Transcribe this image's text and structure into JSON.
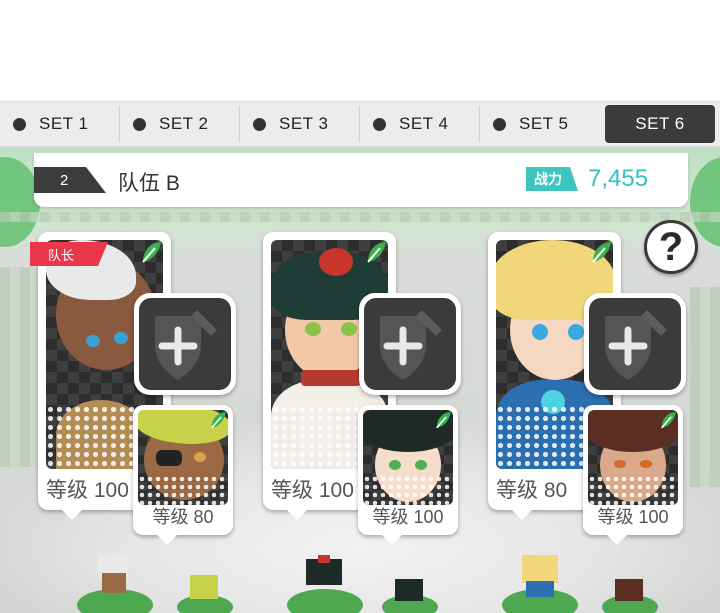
{
  "tabs": [
    {
      "label": "SET 1",
      "active": false
    },
    {
      "label": "SET 2",
      "active": false
    },
    {
      "label": "SET 3",
      "active": false
    },
    {
      "label": "SET 4",
      "active": false
    },
    {
      "label": "SET 5",
      "active": false
    },
    {
      "label": "SET 6",
      "active": true
    }
  ],
  "team": {
    "number": "2",
    "name": "队伍 B",
    "power_label": "战力",
    "power_value": "7,455"
  },
  "help_label": "?",
  "heroes": [
    {
      "level_label": "等级 100",
      "leader_label": "队长",
      "element": "wind"
    },
    {
      "level_label": "等级 100",
      "element": "wind"
    },
    {
      "level_label": "等级 80",
      "element": "wind"
    }
  ],
  "subs": [
    {
      "level_label": "等级 80",
      "element": "wind"
    },
    {
      "level_label": "等级 100",
      "element": "wind"
    },
    {
      "level_label": "等级 100",
      "element": "wind"
    }
  ],
  "colors": {
    "accent_teal": "#3fc5c0",
    "leader_red": "#e8384a",
    "wind_green": "#38b34a",
    "dark": "#3b3b3b"
  }
}
